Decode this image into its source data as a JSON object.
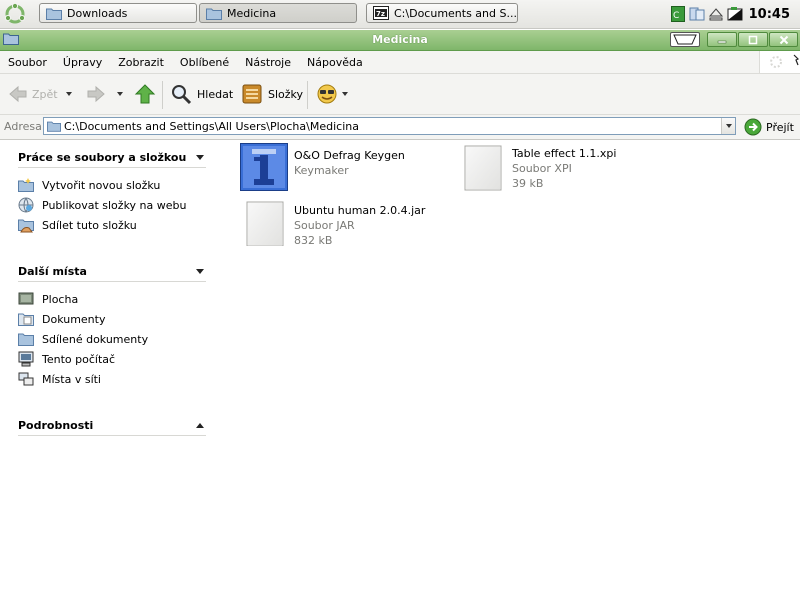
{
  "taskbar": {
    "tasks": [
      {
        "label": "Downloads",
        "active": false
      },
      {
        "label": "Medicina",
        "active": true
      },
      {
        "label": "C:\\Documents and S...",
        "active": false
      }
    ],
    "clock": "10:45"
  },
  "window": {
    "title": "Medicina"
  },
  "menu": {
    "items": [
      "Soubor",
      "Úpravy",
      "Zobrazit",
      "Oblíbené",
      "Nástroje",
      "Nápověda"
    ]
  },
  "toolbar": {
    "back_label": "Zpět",
    "search_label": "Hledat",
    "folders_label": "Složky"
  },
  "address": {
    "label": "Adresa",
    "path": "C:\\Documents and Settings\\All Users\\Plocha\\Medicina",
    "go_label": "Přejít"
  },
  "sidebar": {
    "tasks_title": "Práce se soubory a složkou",
    "tasks": [
      {
        "label": "Vytvořit novou složku",
        "icon": "new-folder-icon"
      },
      {
        "label": "Publikovat složky na webu",
        "icon": "web-publish-icon"
      },
      {
        "label": "Sdílet tuto složku",
        "icon": "share-folder-icon"
      }
    ],
    "places_title": "Další místa",
    "places": [
      {
        "label": "Plocha",
        "icon": "desktop-icon"
      },
      {
        "label": "Dokumenty",
        "icon": "documents-icon"
      },
      {
        "label": "Sdílené dokumenty",
        "icon": "shared-documents-icon"
      },
      {
        "label": "Tento počítač",
        "icon": "computer-icon"
      },
      {
        "label": "Místa v síti",
        "icon": "network-icon"
      }
    ],
    "details_title": "Podrobnosti"
  },
  "files": [
    {
      "name": "O&O Defrag Keygen",
      "line2": "Keymaker",
      "line3": "",
      "icon": "keygen-icon"
    },
    {
      "name": "Table effect 1.1.xpi",
      "line2": "Soubor XPI",
      "line3": "39 kB",
      "icon": "blank-file-icon"
    },
    {
      "name": "Ubuntu human 2.0.4.jar",
      "line2": "Soubor JAR",
      "line3": "832 kB",
      "icon": "blank-file-icon"
    }
  ],
  "colors": {
    "title_green": "#7fb66a",
    "go_green": "#4aa83a"
  }
}
